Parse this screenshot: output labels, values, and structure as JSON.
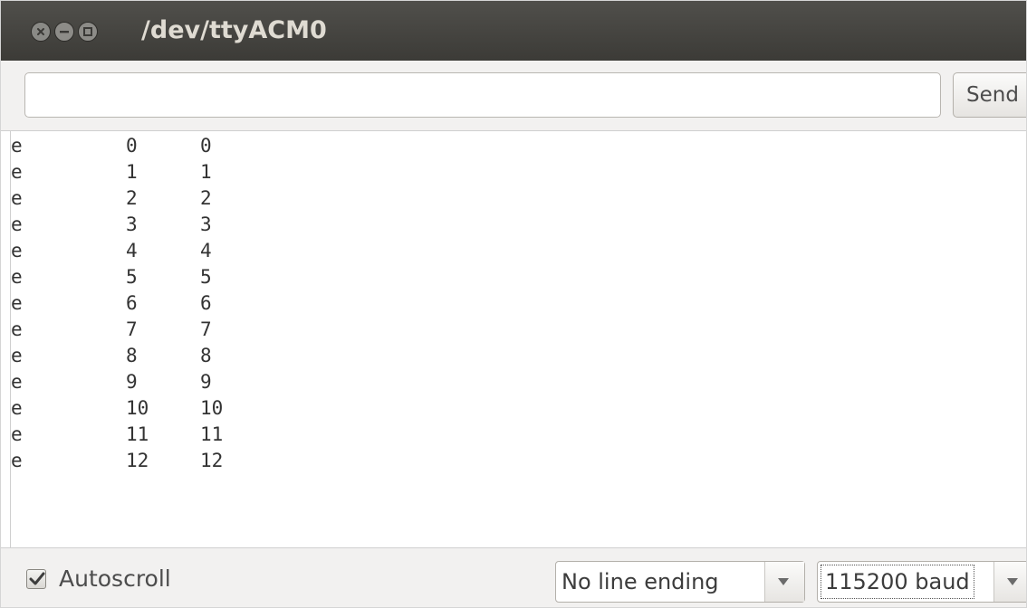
{
  "window": {
    "title": "/dev/ttyACM0"
  },
  "input_row": {
    "input_value": "",
    "input_placeholder": "",
    "send_label": "Send"
  },
  "console": {
    "lines": [
      [
        "e",
        "0",
        "0"
      ],
      [
        "e",
        "1",
        "1"
      ],
      [
        "e",
        "2",
        "2"
      ],
      [
        "e",
        "3",
        "3"
      ],
      [
        "e",
        "4",
        "4"
      ],
      [
        "e",
        "5",
        "5"
      ],
      [
        "e",
        "6",
        "6"
      ],
      [
        "e",
        "7",
        "7"
      ],
      [
        "e",
        "8",
        "8"
      ],
      [
        "e",
        "9",
        "9"
      ],
      [
        "e",
        "10",
        "10"
      ],
      [
        "e",
        "11",
        "11"
      ],
      [
        "e",
        "12",
        "12"
      ]
    ]
  },
  "bottom_bar": {
    "autoscroll_label": "Autoscroll",
    "autoscroll_checked": true,
    "line_ending_value": "No line ending",
    "baud_value": "115200 baud"
  },
  "icons": {
    "close": "close-icon",
    "minimize": "minimize-icon",
    "maximize": "maximize-icon",
    "dropdown": "chevron-down-icon",
    "check": "checkmark-icon"
  },
  "colors": {
    "titlebar": "#3c3b37",
    "title_text": "#dfdbd2",
    "panel": "#f2f1f0",
    "console_text": "#333333"
  }
}
